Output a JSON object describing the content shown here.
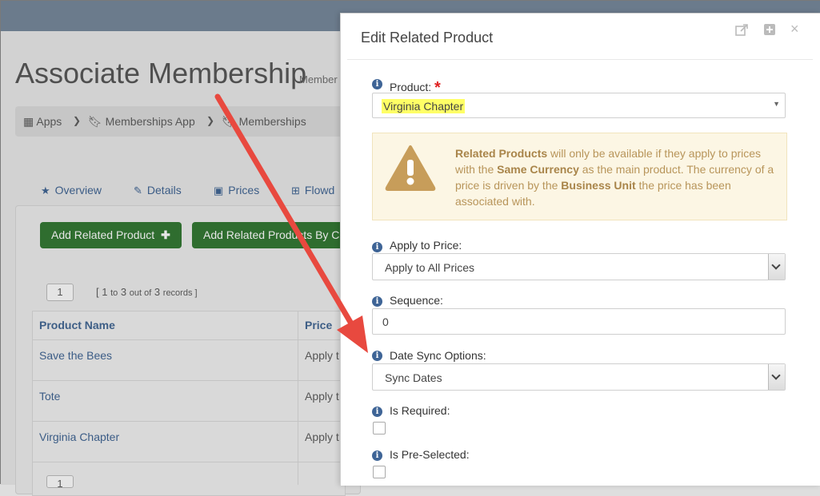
{
  "page": {
    "title": "Associate Membership",
    "subtitle": "Member",
    "breadcrumb": [
      "Apps",
      "Memberships App",
      "Memberships"
    ],
    "tabs": [
      "Overview",
      "Details",
      "Prices",
      "Flowd"
    ],
    "buttons": {
      "add_related": "Add Related Product",
      "add_related_by": "Add Related Products By C"
    },
    "pager": {
      "page": "1",
      "range_prefix": "[ 1",
      "range_to": "to",
      "range_mid": "3",
      "range_outof": "out of",
      "range_count": "3",
      "range_suffix": "records ]"
    },
    "grid": {
      "headers": [
        "Product Name",
        "Price"
      ],
      "rows": [
        {
          "name": "Save the Bees",
          "price": "Apply t"
        },
        {
          "name": "Tote",
          "price": "Apply t"
        },
        {
          "name": "Virginia Chapter",
          "price": "Apply t"
        }
      ],
      "footer_page": "1"
    }
  },
  "modal": {
    "title": "Edit Related Product",
    "product": {
      "label": "Product:",
      "required_mark": "*",
      "value": "Virginia Chapter"
    },
    "warning": {
      "b1": "Related Products",
      "t1": " will only be available if they apply to prices with the ",
      "b2": "Same Currency",
      "t2": " as the main product. The currency of a price is driven by the ",
      "b3": "Business Unit",
      "t3": " the price has been associated with."
    },
    "apply_price": {
      "label": "Apply to Price:",
      "value": "Apply to All Prices"
    },
    "sequence": {
      "label": "Sequence:",
      "value": "0"
    },
    "date_sync": {
      "label": "Date Sync Options:",
      "value": "Sync Dates"
    },
    "is_required": {
      "label": "Is Required:"
    },
    "is_preselected": {
      "label": "Is Pre-Selected:"
    }
  },
  "colors": {
    "accent_blue": "#3e6496",
    "warning_text": "#b8955a",
    "warning_bg": "#fcf6e4",
    "arrow_red": "#e8493f",
    "green_button": "#2f6d2f"
  }
}
